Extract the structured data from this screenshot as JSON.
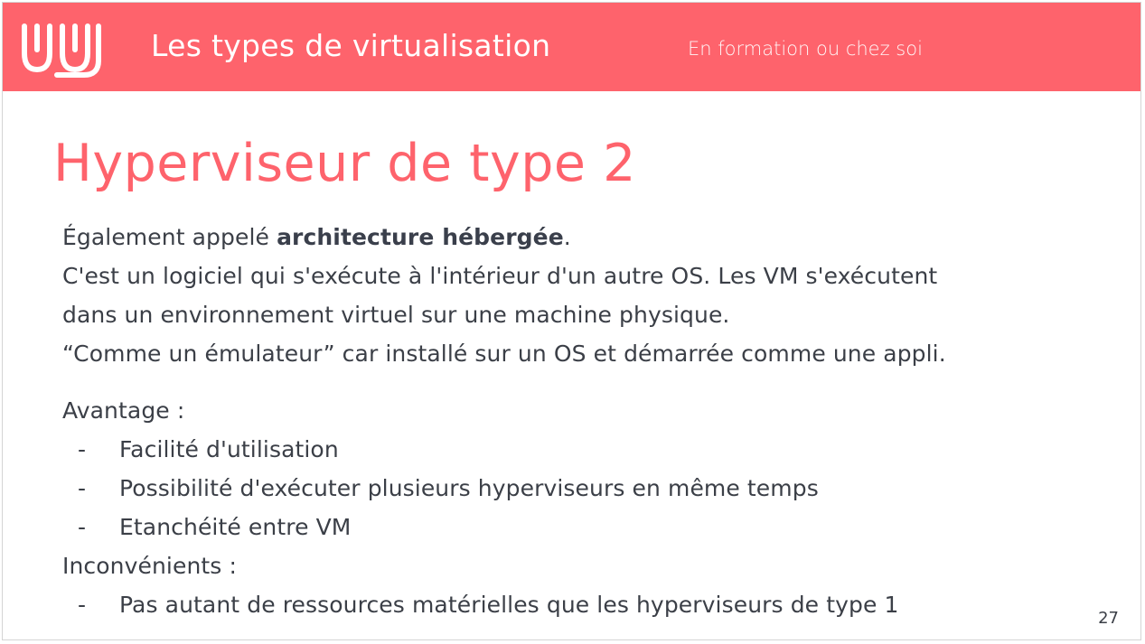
{
  "header": {
    "title": "Les types de virtualisation",
    "subtitle": "En formation ou chez soi",
    "logo_icon": "wave-logo-icon"
  },
  "slide": {
    "title": "Hyperviseur de type 2",
    "intro": {
      "prefix": "Également appelé ",
      "bold": "architecture hébergée",
      "suffix": "."
    },
    "lines": [
      "C'est un logiciel qui s'exécute à l'intérieur d'un autre OS. Les VM s'exécutent",
      "dans un environnement virtuel sur une machine physique.",
      "“Comme un émulateur” car installé sur un OS et démarrée comme une appli."
    ],
    "advantages": {
      "label": "Avantage :",
      "items": [
        "Facilité d'utilisation",
        "Possibilité d'exécuter plusieurs hyperviseurs en même temps",
        "Etanchéité entre VM"
      ]
    },
    "drawbacks": {
      "label": "Inconvénients :",
      "items": [
        "Pas autant de ressources matérielles que les hyperviseurs de type 1"
      ]
    },
    "bullet_marker": "-",
    "page_number": "27"
  },
  "colors": {
    "accent": "#fe636c",
    "text": "#3b3f47",
    "header_text": "#ffffff"
  }
}
